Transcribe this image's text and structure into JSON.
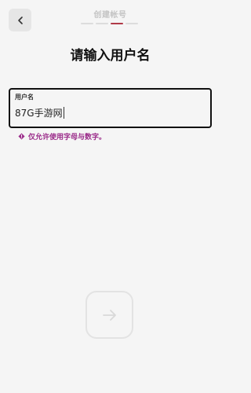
{
  "header": {
    "step_title": "创建帐号",
    "steps": [
      {
        "state": "done"
      },
      {
        "state": "done"
      },
      {
        "state": "active"
      },
      {
        "state": "todo"
      }
    ]
  },
  "main": {
    "title": "请输入用户名",
    "username_field": {
      "label": "用户名",
      "value": "87G手游网"
    },
    "hint": {
      "icon": "warning-diamond-icon",
      "text": "仅允许使用字母与数字。"
    }
  },
  "colors": {
    "accent": "#b03a48",
    "hint": "#9b2c8a",
    "background": "#f5f5f5"
  }
}
